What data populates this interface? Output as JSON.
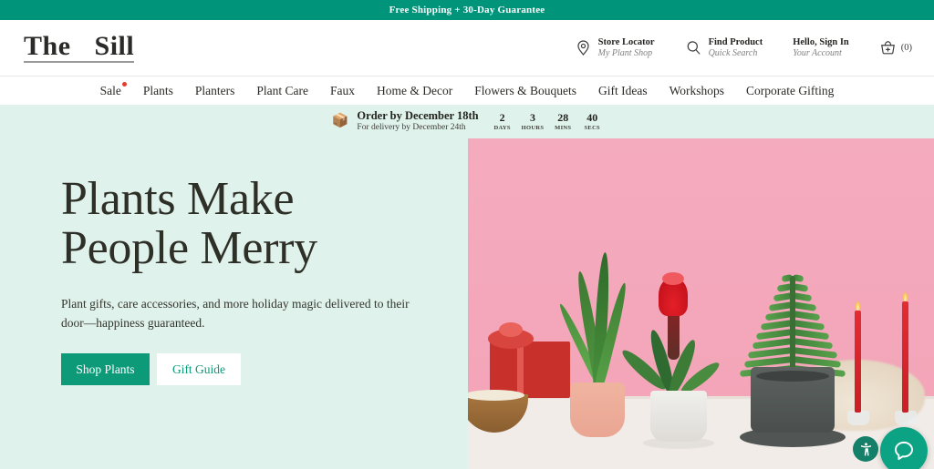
{
  "promo": {
    "text": "Free Shipping + 30-Day Guarantee",
    "bg": "#00947a"
  },
  "header": {
    "logo": {
      "word1": "The",
      "word2": "Sill"
    },
    "utilities": [
      {
        "icon": "location-pin-icon",
        "title": "Store Locator",
        "subtitle": "My Plant Shop"
      },
      {
        "icon": "search-icon",
        "title": "Find Product",
        "subtitle": "Quick Search"
      },
      {
        "icon": "none",
        "title": "Hello, Sign In",
        "subtitle": "Your Account"
      }
    ],
    "cart": {
      "icon": "basket-icon",
      "count": "(0)"
    }
  },
  "nav": {
    "items": [
      {
        "label": "Sale",
        "badge": true
      },
      {
        "label": "Plants",
        "badge": false
      },
      {
        "label": "Planters",
        "badge": false
      },
      {
        "label": "Plant Care",
        "badge": false
      },
      {
        "label": "Faux",
        "badge": false
      },
      {
        "label": "Home & Decor",
        "badge": false
      },
      {
        "label": "Flowers & Bouquets",
        "badge": false
      },
      {
        "label": "Gift Ideas",
        "badge": false
      },
      {
        "label": "Workshops",
        "badge": false
      },
      {
        "label": "Corporate Gifting",
        "badge": false
      }
    ]
  },
  "countdown": {
    "icon": "package-box-icon",
    "headline": "Order by December 18th",
    "subline": "For delivery by December 24th",
    "units": [
      {
        "value": "2",
        "label": "DAYS"
      },
      {
        "value": "3",
        "label": "HOURS"
      },
      {
        "value": "28",
        "label": "MINS"
      },
      {
        "value": "40",
        "label": "SECS"
      }
    ]
  },
  "hero": {
    "heading_line1": "Plants Make",
    "heading_line2": "People Merry",
    "paragraph": "Plant gifts, care accessories, and more holiday magic delivered to their door—happiness guaranteed.",
    "primary_button": "Shop Plants",
    "secondary_button": "Gift Guide",
    "bg_color": "#e0f2ec",
    "image_bg_color": "#f4a9bd",
    "accent_color": "#0c9a78"
  },
  "widgets": {
    "accessibility": "accessibility-icon",
    "chat": "chat-bubble-icon"
  }
}
